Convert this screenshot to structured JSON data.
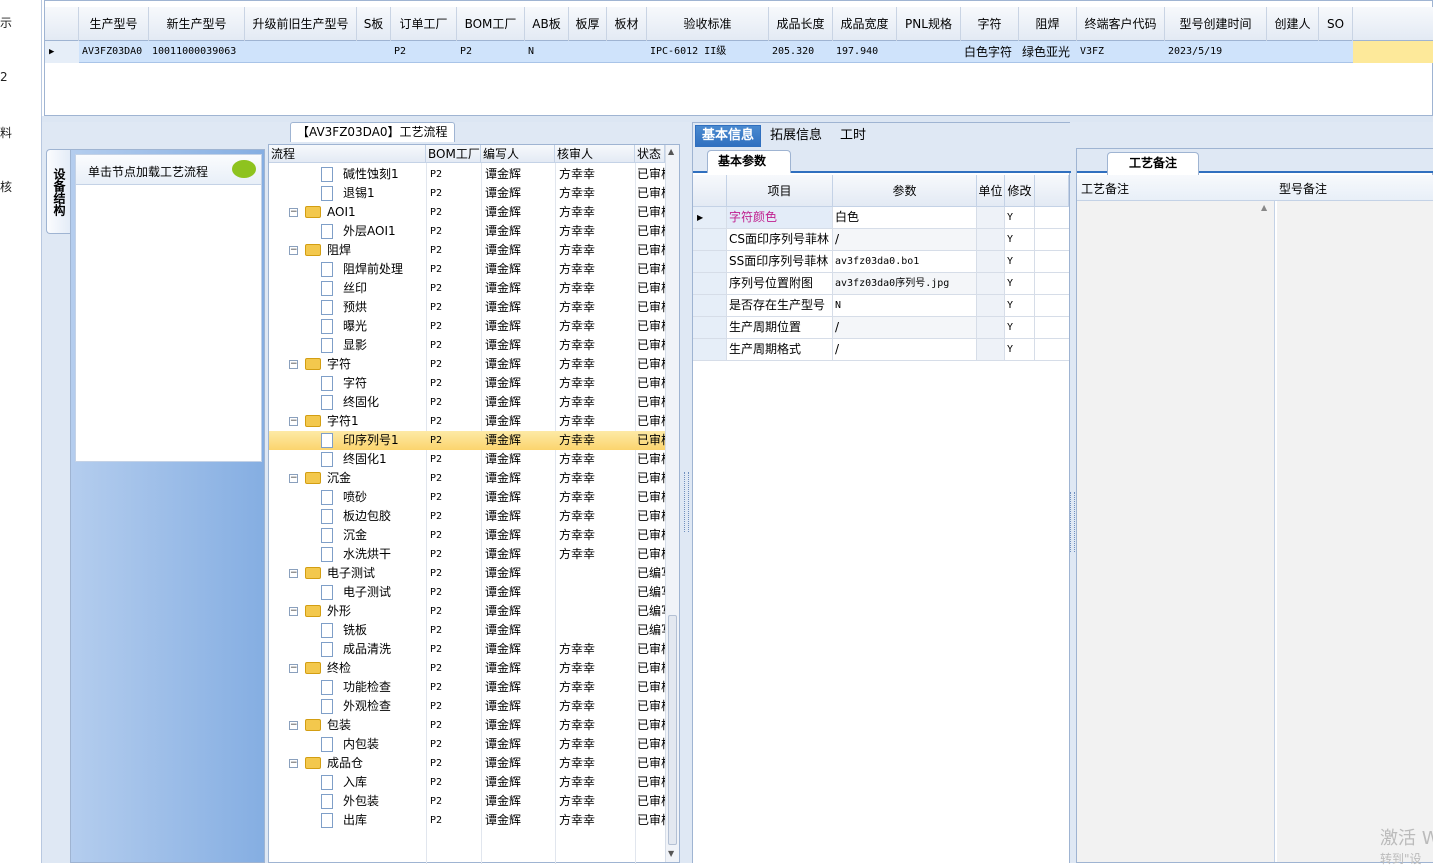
{
  "left_nav": [
    "示",
    "2",
    "料",
    "核"
  ],
  "top_grid": {
    "columns": [
      "生产型号",
      "新生产型号",
      "升级前旧生产型号",
      "S板",
      "订单工厂",
      "BOM工厂",
      "AB板",
      "板厚",
      "板材",
      "验收标准",
      "成品长度",
      "成品宽度",
      "PNL规格",
      "字符",
      "阻焊",
      "终端客户代码",
      "型号创建时间",
      "创建人",
      "SO"
    ],
    "row": {
      "production_model": "AV3FZ03DA0",
      "new_production_model": "10011000039063",
      "old_model": "",
      "s_board": "",
      "order_factory": "P2",
      "bom_factory": "P2",
      "ab_board": "N",
      "thickness": "",
      "material": "",
      "standard": "IPC-6012 II级",
      "length": "205.320",
      "width": "197.940",
      "pnl": "",
      "char": "白色字符",
      "solder": "绿色亚光",
      "customer_code": "V3FZ",
      "created": "2023/5/19",
      "creator": "",
      "so": ""
    }
  },
  "side": {
    "tab_label": "设备结构",
    "hint": "单击节点加载工艺流程"
  },
  "tree": {
    "title": "【AV3FZ03DA0】工艺流程",
    "columns": [
      "流程",
      "BOM工厂",
      "编写人",
      "核审人",
      "状态"
    ],
    "rows": [
      {
        "level": 1,
        "type": "doc",
        "name": "碱性蚀刻1",
        "bom": "P2",
        "writer": "谭金辉",
        "reviewer": "方幸幸",
        "status": "已审核"
      },
      {
        "level": 1,
        "type": "doc",
        "name": "退锡1",
        "bom": "P2",
        "writer": "谭金辉",
        "reviewer": "方幸幸",
        "status": "已审核"
      },
      {
        "level": 0,
        "type": "folder",
        "name": "AOI1",
        "bom": "P2",
        "writer": "谭金辉",
        "reviewer": "方幸幸",
        "status": "已审核"
      },
      {
        "level": 1,
        "type": "doc",
        "name": "外层AOI1",
        "bom": "P2",
        "writer": "谭金辉",
        "reviewer": "方幸幸",
        "status": "已审核"
      },
      {
        "level": 0,
        "type": "folder",
        "name": "阻焊",
        "bom": "P2",
        "writer": "谭金辉",
        "reviewer": "方幸幸",
        "status": "已审核"
      },
      {
        "level": 1,
        "type": "doc",
        "name": "阻焊前处理",
        "bom": "P2",
        "writer": "谭金辉",
        "reviewer": "方幸幸",
        "status": "已审核"
      },
      {
        "level": 1,
        "type": "doc",
        "name": "丝印",
        "bom": "P2",
        "writer": "谭金辉",
        "reviewer": "方幸幸",
        "status": "已审核"
      },
      {
        "level": 1,
        "type": "doc",
        "name": "预烘",
        "bom": "P2",
        "writer": "谭金辉",
        "reviewer": "方幸幸",
        "status": "已审核"
      },
      {
        "level": 1,
        "type": "doc",
        "name": "曝光",
        "bom": "P2",
        "writer": "谭金辉",
        "reviewer": "方幸幸",
        "status": "已审核"
      },
      {
        "level": 1,
        "type": "doc",
        "name": "显影",
        "bom": "P2",
        "writer": "谭金辉",
        "reviewer": "方幸幸",
        "status": "已审核"
      },
      {
        "level": 0,
        "type": "folder",
        "name": "字符",
        "bom": "P2",
        "writer": "谭金辉",
        "reviewer": "方幸幸",
        "status": "已审核"
      },
      {
        "level": 1,
        "type": "doc",
        "name": "字符",
        "bom": "P2",
        "writer": "谭金辉",
        "reviewer": "方幸幸",
        "status": "已审核"
      },
      {
        "level": 1,
        "type": "doc",
        "name": "终固化",
        "bom": "P2",
        "writer": "谭金辉",
        "reviewer": "方幸幸",
        "status": "已审核"
      },
      {
        "level": 0,
        "type": "folder",
        "name": "字符1",
        "bom": "P2",
        "writer": "谭金辉",
        "reviewer": "方幸幸",
        "status": "已审核"
      },
      {
        "level": 1,
        "type": "doc",
        "name": "印序列号1",
        "bom": "P2",
        "writer": "谭金辉",
        "reviewer": "方幸幸",
        "status": "已审核",
        "selected": true
      },
      {
        "level": 1,
        "type": "doc",
        "name": "终固化1",
        "bom": "P2",
        "writer": "谭金辉",
        "reviewer": "方幸幸",
        "status": "已审核"
      },
      {
        "level": 0,
        "type": "folder",
        "name": "沉金",
        "bom": "P2",
        "writer": "谭金辉",
        "reviewer": "方幸幸",
        "status": "已审核"
      },
      {
        "level": 1,
        "type": "doc",
        "name": "喷砂",
        "bom": "P2",
        "writer": "谭金辉",
        "reviewer": "方幸幸",
        "status": "已审核"
      },
      {
        "level": 1,
        "type": "doc",
        "name": "板边包胶",
        "bom": "P2",
        "writer": "谭金辉",
        "reviewer": "方幸幸",
        "status": "已审核"
      },
      {
        "level": 1,
        "type": "doc",
        "name": "沉金",
        "bom": "P2",
        "writer": "谭金辉",
        "reviewer": "方幸幸",
        "status": "已审核"
      },
      {
        "level": 1,
        "type": "doc",
        "name": "水洗烘干",
        "bom": "P2",
        "writer": "谭金辉",
        "reviewer": "方幸幸",
        "status": "已审核"
      },
      {
        "level": 0,
        "type": "folder",
        "name": "电子测试",
        "bom": "P2",
        "writer": "谭金辉",
        "reviewer": "",
        "status": "已编写"
      },
      {
        "level": 1,
        "type": "doc",
        "name": "电子测试",
        "bom": "P2",
        "writer": "谭金辉",
        "reviewer": "",
        "status": "已编写"
      },
      {
        "level": 0,
        "type": "folder",
        "name": "外形",
        "bom": "P2",
        "writer": "谭金辉",
        "reviewer": "",
        "status": "已编写"
      },
      {
        "level": 1,
        "type": "doc",
        "name": "铣板",
        "bom": "P2",
        "writer": "谭金辉",
        "reviewer": "",
        "status": "已编写"
      },
      {
        "level": 1,
        "type": "doc",
        "name": "成品清洗",
        "bom": "P2",
        "writer": "谭金辉",
        "reviewer": "方幸幸",
        "status": "已审核"
      },
      {
        "level": 0,
        "type": "folder",
        "name": "终检",
        "bom": "P2",
        "writer": "谭金辉",
        "reviewer": "方幸幸",
        "status": "已审核"
      },
      {
        "level": 1,
        "type": "doc",
        "name": "功能检查",
        "bom": "P2",
        "writer": "谭金辉",
        "reviewer": "方幸幸",
        "status": "已审核"
      },
      {
        "level": 1,
        "type": "doc",
        "name": "外观检查",
        "bom": "P2",
        "writer": "谭金辉",
        "reviewer": "方幸幸",
        "status": "已审核"
      },
      {
        "level": 0,
        "type": "folder",
        "name": "包装",
        "bom": "P2",
        "writer": "谭金辉",
        "reviewer": "方幸幸",
        "status": "已审核"
      },
      {
        "level": 1,
        "type": "doc",
        "name": "内包装",
        "bom": "P2",
        "writer": "谭金辉",
        "reviewer": "方幸幸",
        "status": "已审核"
      },
      {
        "level": 0,
        "type": "folder",
        "name": "成品仓",
        "bom": "P2",
        "writer": "谭金辉",
        "reviewer": "方幸幸",
        "status": "已审核"
      },
      {
        "level": 1,
        "type": "doc",
        "name": "入库",
        "bom": "P2",
        "writer": "谭金辉",
        "reviewer": "方幸幸",
        "status": "已审核"
      },
      {
        "level": 1,
        "type": "doc",
        "name": "外包装",
        "bom": "P2",
        "writer": "谭金辉",
        "reviewer": "方幸幸",
        "status": "已审核"
      },
      {
        "level": 1,
        "type": "doc",
        "name": "出库",
        "bom": "P2",
        "writer": "谭金辉",
        "reviewer": "方幸幸",
        "status": "已审核"
      }
    ]
  },
  "mid": {
    "tabs": [
      "基本信息",
      "拓展信息",
      "工时"
    ],
    "subtab": "基本参数",
    "columns": [
      "项目",
      "参数",
      "单位",
      "修改"
    ],
    "rows": [
      {
        "item": "字符颜色",
        "value": "白色",
        "unit": "",
        "mod": "Y",
        "highlight": true
      },
      {
        "item": "CS面印序列号菲林",
        "value": "/",
        "unit": "",
        "mod": "Y"
      },
      {
        "item": "SS面印序列号菲林",
        "value": "av3fz03da0.bo1",
        "unit": "",
        "mod": "Y"
      },
      {
        "item": "序列号位置附图",
        "value": "av3fz03da0序列号.jpg",
        "unit": "",
        "mod": "Y"
      },
      {
        "item": "是否存在生产型号",
        "value": "N",
        "unit": "",
        "mod": "Y"
      },
      {
        "item": "生产周期位置",
        "value": "/",
        "unit": "",
        "mod": "Y"
      },
      {
        "item": "生产周期格式",
        "value": "/",
        "unit": "",
        "mod": "Y"
      }
    ]
  },
  "right": {
    "tab": "工艺备注",
    "col1": "工艺备注",
    "col2": "型号备注"
  },
  "watermark": {
    "line1": "激活 W",
    "line2": "转到\"设"
  },
  "colors": {
    "selection": "#fbd46d",
    "accent": "#2f6fbf",
    "highlight_text": "#c0208f"
  }
}
